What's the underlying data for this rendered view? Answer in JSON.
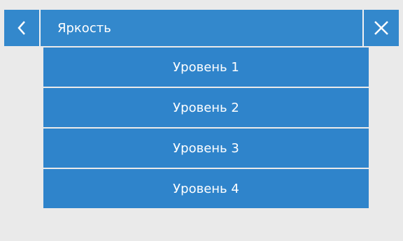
{
  "header": {
    "back_icon": "chevron-left-icon",
    "title": "Яркость",
    "close_icon": "close-icon"
  },
  "levels": [
    {
      "label": "Уровень 1"
    },
    {
      "label": "Уровень 2"
    },
    {
      "label": "Уровень 3"
    },
    {
      "label": "Уровень 4"
    }
  ],
  "colors": {
    "primary": "#3388cc",
    "item": "#2f84cb",
    "background": "#eaeaea",
    "text": "#ffffff"
  }
}
